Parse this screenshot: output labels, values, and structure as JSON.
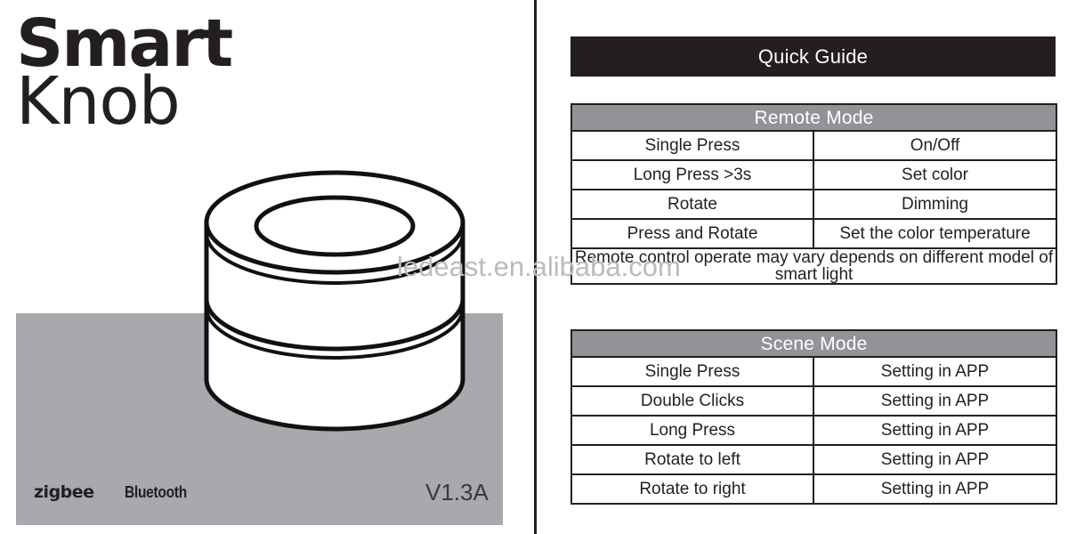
{
  "product": {
    "title_line_1": "Smart",
    "title_line_2": "Knob",
    "version": "V1.3A",
    "illustration_name": "smart-knob-cylinder-illustration"
  },
  "badges": {
    "zigbee": "zigbee",
    "bluetooth": "Bluetooth"
  },
  "watermark": {
    "text": "ledeast.en.alibaba.com"
  },
  "guide": {
    "banner_title": "Quick Guide",
    "remote_mode": {
      "header": "Remote Mode",
      "rows": [
        {
          "action": "Single Press",
          "result": "On/Off"
        },
        {
          "action": "Long Press >3s",
          "result": "Set color"
        },
        {
          "action": "Rotate",
          "result": "Dimming"
        },
        {
          "action": "Press and Rotate",
          "result": "Set the color temperature"
        }
      ],
      "note": "Remote control operate may vary depends on different model of smart light"
    },
    "scene_mode": {
      "header": "Scene Mode",
      "rows": [
        {
          "action": "Single Press",
          "result": "Setting in APP"
        },
        {
          "action": "Double Clicks",
          "result": "Setting in APP"
        },
        {
          "action": "Long Press",
          "result": "Setting in APP"
        },
        {
          "action": "Rotate to left",
          "result": "Setting in APP"
        },
        {
          "action": "Rotate to right",
          "result": "Setting in APP"
        }
      ]
    }
  },
  "colors": {
    "ink": "#231f20",
    "plate_gray": "#a7a9ac",
    "header_gray": "#919396",
    "watermark_gray": "#b9bbbd"
  }
}
